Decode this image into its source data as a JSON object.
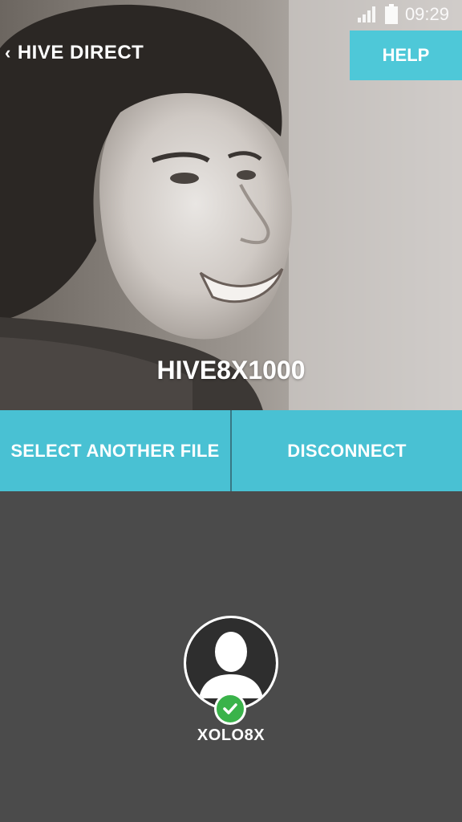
{
  "status": {
    "time": "09:29"
  },
  "header": {
    "back_label": "HIVE DIRECT",
    "help_label": "HELP"
  },
  "file": {
    "name": "HIVE8X1000"
  },
  "actions": {
    "select_label": "SELECT ANOTHER FILE",
    "disconnect_label": "DISCONNECT"
  },
  "device": {
    "name": "XOLO8X",
    "status_icon": "check-icon",
    "avatar_icon": "person-silhouette-icon"
  },
  "colors": {
    "accent": "#4ec8d8",
    "bottom_bg": "#4b4b4b",
    "check": "#3ab34a"
  }
}
